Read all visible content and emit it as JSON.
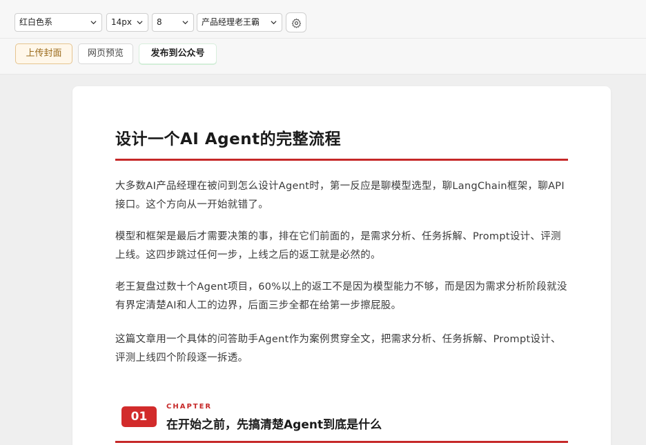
{
  "toolbar": {
    "theme_select": "红白色系",
    "font_size_select": "14px",
    "spacing_select": "8",
    "author_select": "产品经理老王霸",
    "upload_cover_label": "上传封面",
    "web_preview_label": "网页预览",
    "publish_label": "发布到公众号"
  },
  "article": {
    "title": "设计一个AI Agent的完整流程",
    "paragraphs": [
      "大多数AI产品经理在被问到怎么设计Agent时，第一反应是聊模型选型，聊LangChain框架，聊API接口。这个方向从一开始就错了。",
      "模型和框架是最后才需要决策的事，排在它们前面的，是需求分析、任务拆解、Prompt设计、评测上线。这四步跳过任何一步，上线之后的返工就是必然的。",
      "老王复盘过数十个Agent项目，60%以上的返工不是因为模型能力不够，而是因为需求分析阶段就没有界定清楚AI和人工的边界，后面三步全都在给第一步擦屁股。",
      "这篇文章用一个具体的问答助手Agent作为案例贯穿全文，把需求分析、任务拆解、Prompt设计、评测上线四个阶段逐一拆透。"
    ],
    "chapter": {
      "number": "01",
      "label": "CHAPTER",
      "title": "在开始之前，先搞清楚Agent到底是什么"
    }
  },
  "colors": {
    "accent": "#c62828",
    "badge": "#d22b2b",
    "cover_button_bg": "#fff7ea",
    "cover_button_border": "#e5c48f"
  },
  "icons": {
    "dropdown": "chevron-down-icon",
    "settings": "gear-icon"
  }
}
